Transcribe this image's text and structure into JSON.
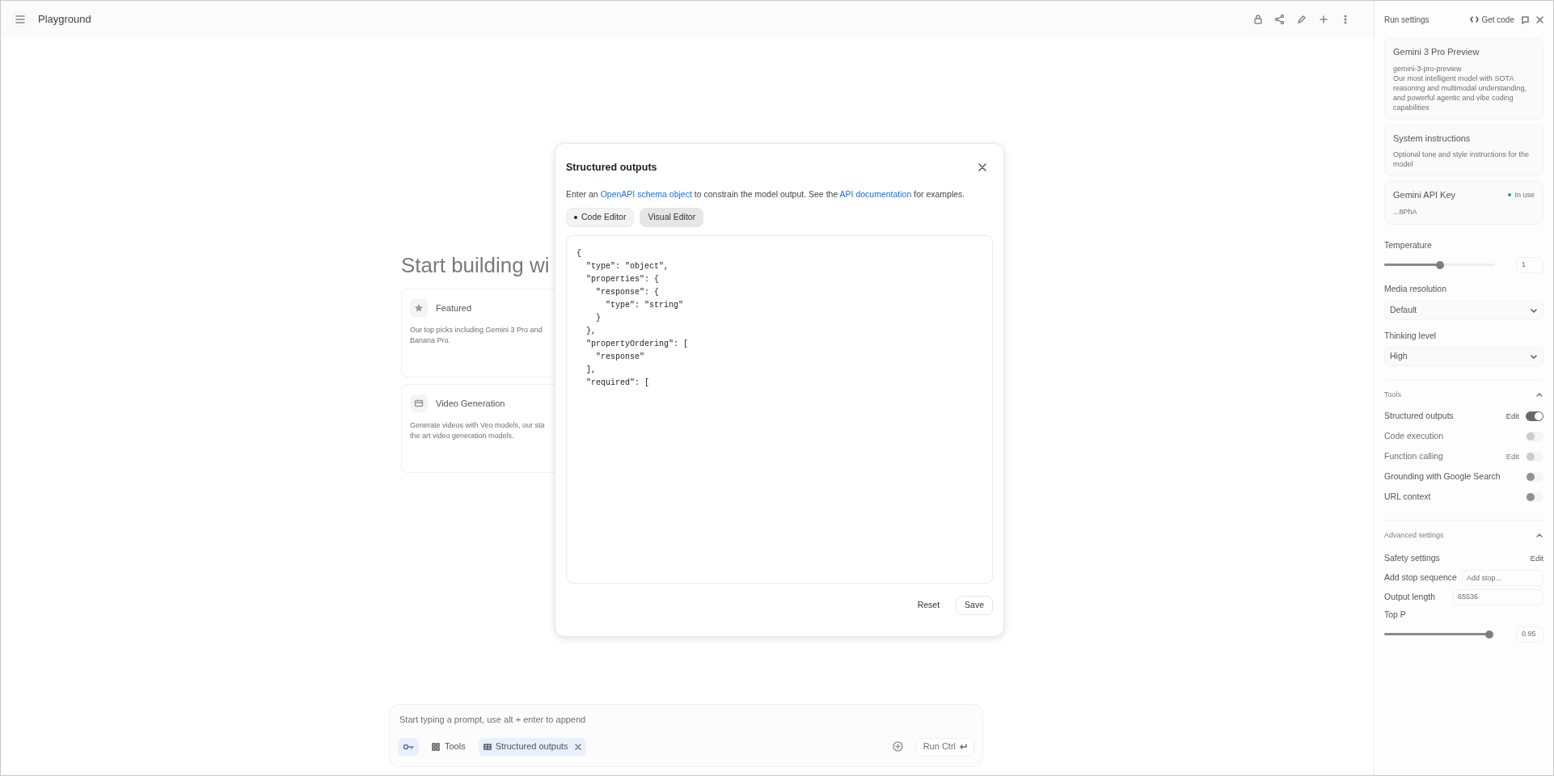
{
  "top_bar": {
    "title": "Playground"
  },
  "main": {
    "heading": "Start building wi",
    "cards": [
      {
        "kind": "star",
        "title": "Featured",
        "lines": [
          "Our top picks including Gemini 3 Pro and",
          "Banana Pro."
        ]
      },
      {
        "kind": "video",
        "title": "Video Generation",
        "lines": [
          "Generate videos with Veo models, our sta",
          "the art video generation models."
        ]
      }
    ]
  },
  "prompt": {
    "placeholder": "Start typing a prompt, use alt + enter to append",
    "tools_label": "Tools",
    "chip": "Structured outputs",
    "run_label": "Run Ctrl"
  },
  "run_settings": {
    "title": "Run settings",
    "get_code": "Get code",
    "model": {
      "name": "Gemini 3 Pro Preview",
      "id": "gemini-3-pro-preview",
      "description": "Our most intelligent model with SOTA reasoning and multimodal understanding, and powerful agentic and vibe coding capabilities"
    },
    "system_instructions": {
      "title": "System instructions",
      "placeholder": "Optional tone and style instructions for the model"
    },
    "api_key": {
      "title": "Gemini API Key",
      "status": "In use",
      "value": "...8PhA"
    },
    "temperature": {
      "label": "Temperature",
      "level": 0.5,
      "value": "1"
    },
    "media_resolution": {
      "label": "Media resolution",
      "value": "Default"
    },
    "thinking_level": {
      "label": "Thinking level",
      "value": "High"
    },
    "tools": {
      "title": "Tools",
      "expanded": true,
      "items": [
        {
          "label": "Structured outputs",
          "edit": "Edit",
          "on": true,
          "disabled": false
        },
        {
          "label": "Code execution",
          "on": false,
          "disabled": true
        },
        {
          "label": "Function calling",
          "edit": "Edit",
          "on": false,
          "disabled": true
        },
        {
          "label": "Grounding with Google Search",
          "on": false,
          "disabled": false
        },
        {
          "label": "URL context",
          "on": false,
          "disabled": false
        }
      ]
    },
    "advanced": {
      "title": "Advanced settings",
      "expanded": true,
      "safety": {
        "label": "Safety settings",
        "edit": "Edit"
      },
      "stop_sequence": {
        "label": "Add stop sequence",
        "placeholder": "Add stop..."
      },
      "output_length": {
        "label": "Output length",
        "value": "65536"
      },
      "top_p": {
        "label": "Top P",
        "level": 0.95,
        "value": "0.95"
      }
    }
  },
  "dialog": {
    "title": "Structured outputs",
    "description": [
      {
        "kind": "text",
        "text": "Enter an "
      },
      {
        "kind": "link",
        "text": "OpenAPI schema object"
      },
      {
        "kind": "text",
        "text": " to constrain the model output. See the "
      },
      {
        "kind": "link",
        "text": "API documentation"
      },
      {
        "kind": "text",
        "text": " for examples."
      }
    ],
    "tabs": [
      {
        "label": "Code Editor",
        "selected": true
      },
      {
        "label": "Visual Editor",
        "selected": false
      }
    ],
    "code": "{\n  \"type\": \"object\",\n  \"properties\": {\n    \"response\": {\n      \"type\": \"string\"\n    }\n  },\n  \"propertyOrdering\": [\n    \"response\"\n  ],\n  \"required\": [",
    "buttons": [
      {
        "label": "Reset",
        "kind": "text"
      },
      {
        "label": "Save",
        "kind": "outline"
      }
    ]
  }
}
